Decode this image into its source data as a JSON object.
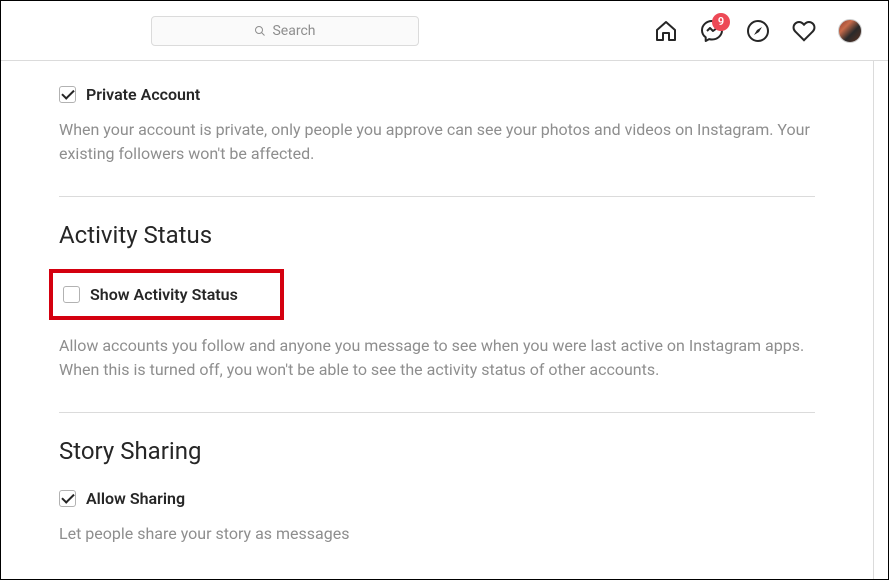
{
  "header": {
    "search_placeholder": "Search",
    "badge_count": "9"
  },
  "sections": {
    "private": {
      "checkbox_label": "Private Account",
      "desc": "When your account is private, only people you approve can see your photos and videos on Instagram. Your existing followers won't be affected."
    },
    "activity": {
      "title": "Activity Status",
      "checkbox_label": "Show Activity Status",
      "desc": "Allow accounts you follow and anyone you message to see when you were last active on Instagram apps. When this is turned off, you won't be able to see the activity status of other accounts."
    },
    "story": {
      "title": "Story Sharing",
      "checkbox_label": "Allow Sharing",
      "desc": "Let people share your story as messages"
    }
  }
}
